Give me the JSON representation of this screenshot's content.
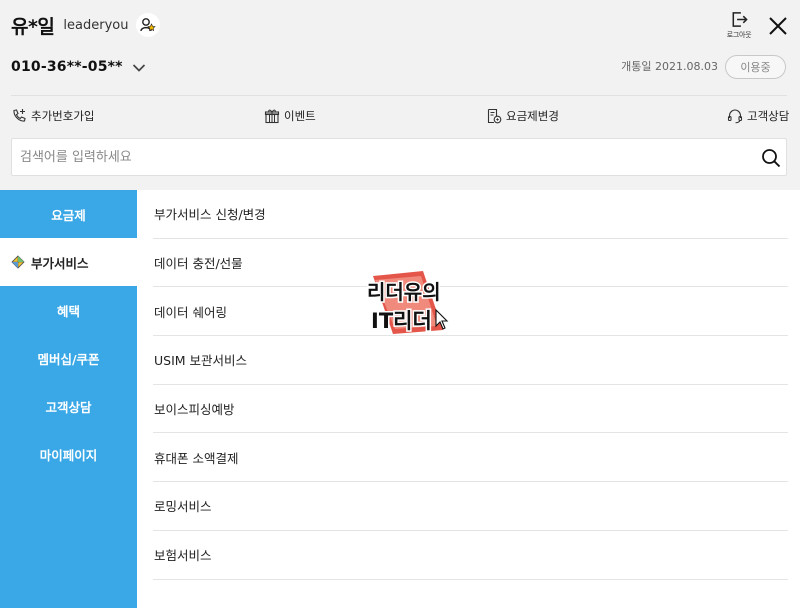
{
  "header": {
    "user_name": "유*일",
    "user_id": "leaderyou",
    "logout_label": "로그아웃",
    "phone_number": "010-36**-05**",
    "open_date": "개통일 2021.08.03",
    "status": "이용중"
  },
  "quick_menu": [
    {
      "label": "추가번호가입",
      "icon": "phone-plus-icon"
    },
    {
      "label": "이벤트",
      "icon": "gift-icon"
    },
    {
      "label": "요금제변경",
      "icon": "plan-change-icon"
    },
    {
      "label": "고객상담",
      "icon": "headset-icon"
    }
  ],
  "search": {
    "placeholder": "검색어를 입력하세요",
    "value": ""
  },
  "sidebar": {
    "active_index": 1,
    "items": [
      {
        "label": "요금제"
      },
      {
        "label": "부가서비스"
      },
      {
        "label": "혜택"
      },
      {
        "label": "멤버십/쿠폰"
      },
      {
        "label": "고객상담"
      },
      {
        "label": "마이페이지"
      }
    ]
  },
  "submenu": {
    "items": [
      {
        "label": "부가서비스 신청/변경"
      },
      {
        "label": "데이터 충전/선물"
      },
      {
        "label": "데이터 쉐어링"
      },
      {
        "label": "USIM 보관서비스"
      },
      {
        "label": "보이스피싱예방"
      },
      {
        "label": "휴대폰 소액결제"
      },
      {
        "label": "로밍서비스"
      },
      {
        "label": "보험서비스"
      }
    ]
  },
  "watermark": {
    "line1": "리더유의",
    "line2": "IT리더"
  },
  "colors": {
    "sidebar": "#3aa8e6",
    "header_bg": "#f2f2f3",
    "watermark_red": "#e2473b"
  }
}
